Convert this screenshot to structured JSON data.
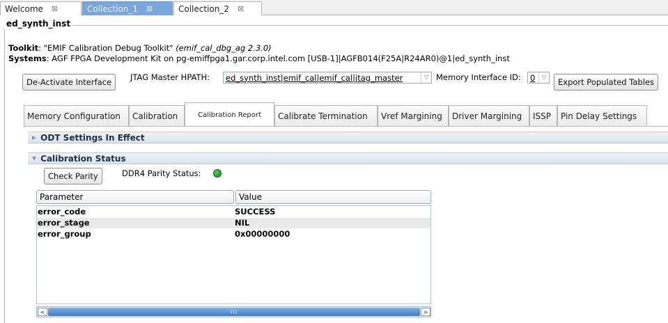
{
  "editor_tabs": [
    {
      "label": "Welcome",
      "close": "⊠"
    },
    {
      "label": "Collection_1",
      "close": "⊠"
    },
    {
      "label": "Collection_2",
      "close": "⊠"
    }
  ],
  "group_title": "ed_synth_inst",
  "toolkit": {
    "label": "Toolkit",
    "value": ": \"EMIF Calibration Debug Toolkit\"",
    "version": "(emif_cal_dbg_ag 2.3.0)"
  },
  "systems": {
    "label": "Systems",
    "value": ": AGF FPGA Development Kit on pg-emiffpga1.gar.corp.intel.com [USB-1]|AGFB014(F25A|R24AR0)@1|ed_synth_inst"
  },
  "controls": {
    "deactivate_label": "De-Activate Interface",
    "jtag_label": "JTAG Master HPATH:",
    "jtag_value": "ed_synth_inst|emif_cal|emif_cal|jtag_master",
    "memory_id_label": "Memory Interface ID:",
    "memory_id_value": "0",
    "export_label": "Export Populated Tables"
  },
  "sub_tabs": [
    "Memory Configuration",
    "Calibration",
    "Calibration Report",
    "Calibrate Termination",
    "Vref Margining",
    "Driver Margining",
    "ISSP",
    "Pin Delay Settings"
  ],
  "sections": {
    "odt": "ODT Settings In Effect",
    "cal_status": "Calibration Status"
  },
  "parity": {
    "button_label": "Check Parity",
    "status_label": "DDR4 Parity Status:",
    "status_color": "#1a9e28"
  },
  "table": {
    "columns": [
      "Parameter",
      "Value"
    ],
    "rows": [
      {
        "parameter": "error_code",
        "value": "SUCCESS"
      },
      {
        "parameter": "error_stage",
        "value": "NIL"
      },
      {
        "parameter": "error_group",
        "value": "0x00000000"
      }
    ]
  },
  "scrollbar": {
    "left_arrow": "<",
    "right_arrow": ">",
    "grip": "III"
  }
}
